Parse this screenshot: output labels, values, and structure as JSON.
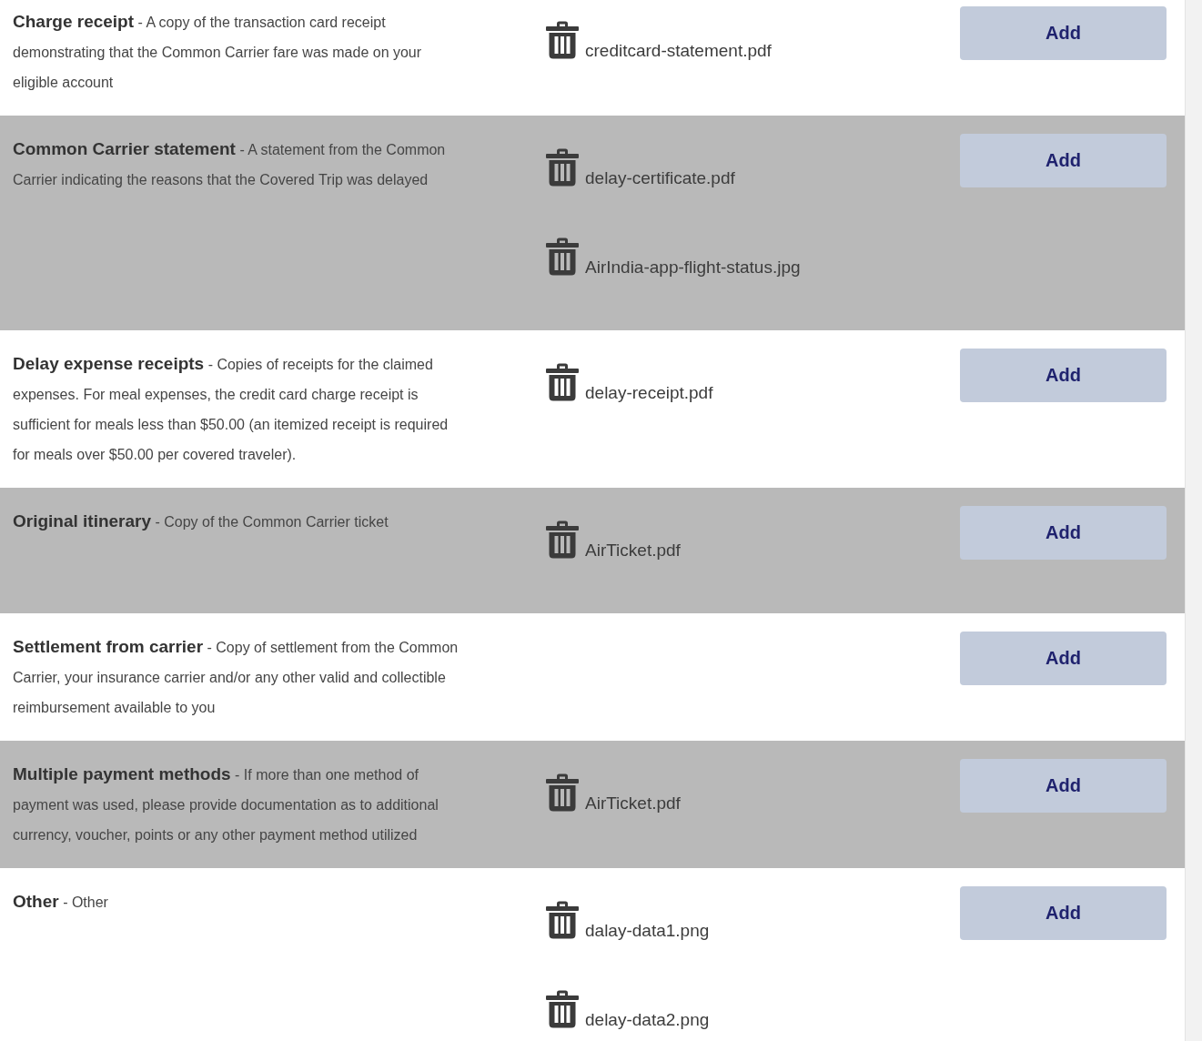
{
  "documents": [
    {
      "text": "**Charge receipt** - A copy of the transaction card receipt demonstrating that the Common Carrier fare was made on your eligible account",
      "files": [
        "creditcard-statement.pdf"
      ],
      "add_button": "Add"
    },
    {
      "text": "**Common Carrier statement** - A statement from the Common Carrier indicating the reasons that the Covered Trip was delayed",
      "files": [
        "delay-certificate.pdf",
        "AirIndia-app-flight-status.jpg"
      ],
      "add_button": "Add"
    },
    {
      "text": "**Delay expense receipts** - Copies of receipts for the claimed expenses. For meal expenses, the credit card charge receipt is sufficient for meals less than $50.00 (an itemized receipt is required for meals over $50.00 per covered traveler).",
      "files": [
        "delay-receipt.pdf"
      ],
      "add_button": "Add"
    },
    {
      "text": "**Original itinerary** - Copy of the Common Carrier ticket",
      "files": [
        "AirTicket.pdf"
      ],
      "add_button": "Add"
    },
    {
      "text": "**Settlement from carrier** - Copy of settlement from the Common Carrier, your insurance carrier and/or any other valid and collectible reimbursement available to you",
      "add_button": "Add"
    },
    {
      "text": "**Multiple payment methods** - If more than one method of payment was used, please provide documentation as to additional currency, voucher, points or any other payment method utilized",
      "files": [
        "AirTicket.pdf"
      ],
      "add_button": "Add"
    },
    {
      "text": "**Other** - Other",
      "files": [
        "dalay-data1.png",
        "delay-data2.png"
      ],
      "add_button": "Add"
    }
  ]
}
